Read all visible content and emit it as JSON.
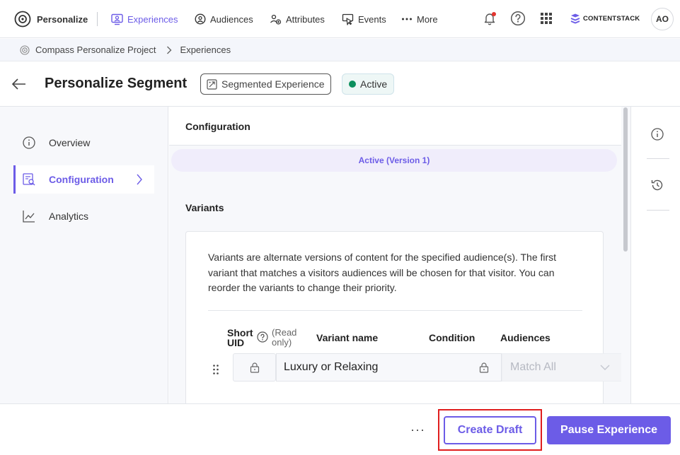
{
  "app": {
    "name": "Personalize",
    "logo_text": "CONTENTSTACK",
    "avatar_initials": "AO"
  },
  "nav": {
    "items": [
      {
        "label": "Experiences",
        "icon": "experiences-icon",
        "active": true
      },
      {
        "label": "Audiences",
        "icon": "audiences-icon",
        "active": false
      },
      {
        "label": "Attributes",
        "icon": "attributes-icon",
        "active": false
      },
      {
        "label": "Events",
        "icon": "events-icon",
        "active": false
      },
      {
        "label": "More",
        "icon": "more-dots-icon",
        "active": false
      }
    ],
    "right_icons": [
      "bell-icon",
      "help-icon",
      "app-grid-icon"
    ]
  },
  "breadcrumb": {
    "project": "Compass Personalize Project",
    "current": "Experiences"
  },
  "header": {
    "title": "Personalize Segment",
    "type_badge": "Segmented Experience",
    "status_badge": "Active"
  },
  "sidebar": {
    "items": [
      {
        "label": "Overview",
        "icon": "info-icon"
      },
      {
        "label": "Configuration",
        "icon": "configuration-icon",
        "active": true
      },
      {
        "label": "Analytics",
        "icon": "analytics-icon"
      }
    ]
  },
  "configuration": {
    "title": "Configuration",
    "version_label": "Active (Version 1)",
    "variants": {
      "title": "Variants",
      "description": "Variants are alternate versions of content for the specified audience(s). The first variant that matches a visitors audiences will be chosen for that visitor. You can reorder the variants to change their priority.",
      "columns": {
        "short_uid_line1": "Short",
        "short_uid_line2": "UID",
        "read_only_line1": "(Read",
        "read_only_line2": "only)",
        "variant_name": "Variant name",
        "condition": "Condition",
        "audiences": "Audiences"
      },
      "rows": [
        {
          "variant_name": "Luxury or Relaxing",
          "audiences_placeholder": "Match All"
        }
      ]
    }
  },
  "footer": {
    "more_label": "···",
    "create_draft": "Create Draft",
    "pause_experience": "Pause Experience"
  },
  "colors": {
    "accent": "#6c5ce7",
    "active_status": "#0c8f5d",
    "highlight": "#e01e1e"
  }
}
